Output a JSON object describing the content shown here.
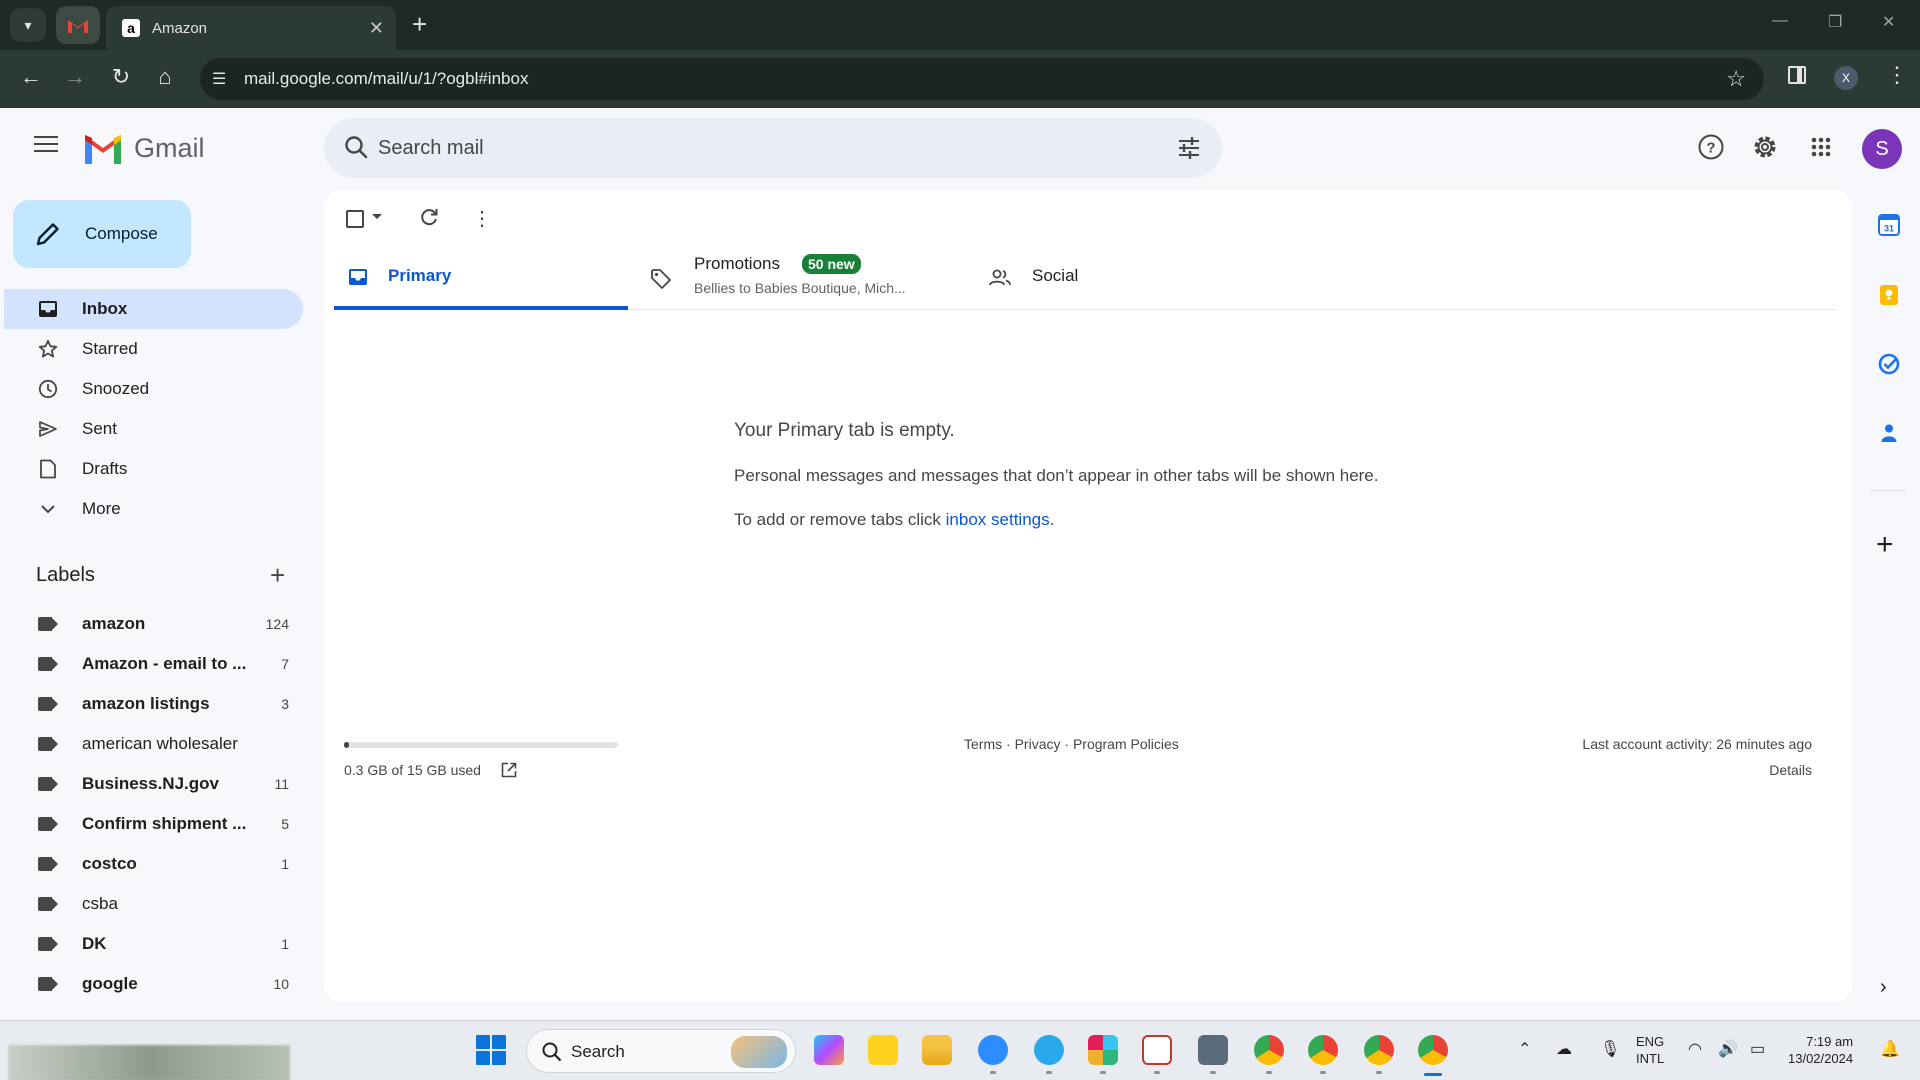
{
  "browser": {
    "tab_title": "Amazon",
    "url": "mail.google.com/mail/u/1/?ogbl#inbox",
    "profile_initial": "X"
  },
  "gmail": {
    "product_name": "Gmail",
    "search_placeholder": "Search mail",
    "account_initial": "S",
    "compose_label": "Compose"
  },
  "nav": {
    "items": [
      {
        "label": "Inbox",
        "icon": "inbox-icon",
        "active": true
      },
      {
        "label": "Starred",
        "icon": "star-icon"
      },
      {
        "label": "Snoozed",
        "icon": "clock-icon"
      },
      {
        "label": "Sent",
        "icon": "send-icon"
      },
      {
        "label": "Drafts",
        "icon": "draft-icon"
      },
      {
        "label": "More",
        "icon": "chevron-down-icon"
      }
    ]
  },
  "labels": {
    "heading": "Labels",
    "items": [
      {
        "name": "amazon",
        "count": "124",
        "bold": true
      },
      {
        "name": "Amazon - email to ...",
        "count": "7",
        "bold": true
      },
      {
        "name": "amazon listings",
        "count": "3",
        "bold": true
      },
      {
        "name": "american wholesaler",
        "count": "",
        "bold": false
      },
      {
        "name": "Business.NJ.gov",
        "count": "11",
        "bold": true
      },
      {
        "name": "Confirm shipment ...",
        "count": "5",
        "bold": true
      },
      {
        "name": "costco",
        "count": "1",
        "bold": true
      },
      {
        "name": "csba",
        "count": "",
        "bold": false
      },
      {
        "name": "DK",
        "count": "1",
        "bold": true
      },
      {
        "name": "google",
        "count": "10",
        "bold": true
      }
    ]
  },
  "tabs": {
    "primary": "Primary",
    "promotions": "Promotions",
    "promotions_badge": "50 new",
    "promotions_senders": "Bellies to Babies Boutique, Mich...",
    "social": "Social"
  },
  "empty": {
    "title": "Your Primary tab is empty.",
    "message": "Personal messages and messages that don’t appear in other tabs will be shown here.",
    "settings_prefix": "To add or remove tabs click ",
    "settings_link": "inbox settings",
    "settings_suffix": "."
  },
  "footer": {
    "storage_used": "0.3 GB of 15 GB used",
    "storage_fraction": 0.02,
    "terms": "Terms",
    "privacy": "Privacy",
    "policies": "Program Policies",
    "sep": " · ",
    "last_activity": "Last account activity: 26 minutes ago",
    "details": "Details"
  },
  "taskbar": {
    "search_label": "Search",
    "lang_1": "ENG",
    "lang_2": "INTL",
    "time": "7:19 am",
    "date": "13/02/2024"
  },
  "colors": {
    "accent": "#0b57d0",
    "compose_bg": "#c2e7ff",
    "active_nav_bg": "#d3e3fd",
    "badge_green": "#188038",
    "avatar_purple": "#7b35b8"
  }
}
